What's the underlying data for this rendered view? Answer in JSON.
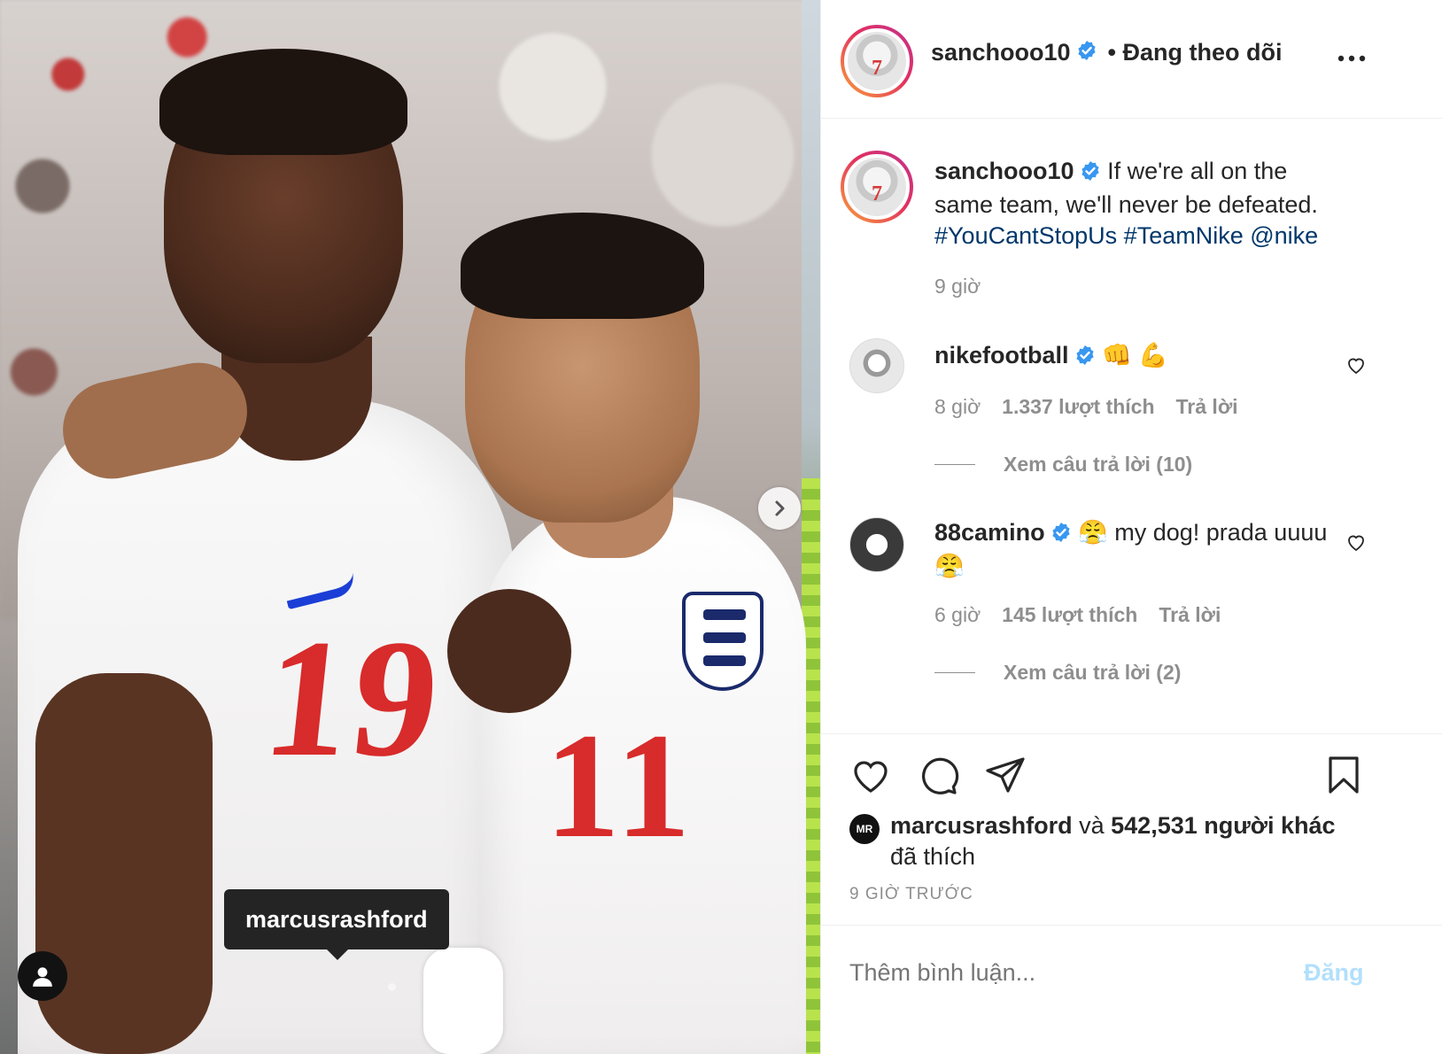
{
  "photo": {
    "tag_label": "marcusrashford",
    "jersey_left_number": "19",
    "jersey_right_number": "11"
  },
  "header": {
    "username": "sanchooo10",
    "follow_status": "• Đang theo dõi"
  },
  "caption": {
    "username": "sanchooo10",
    "text": "If we're all on the same team, we'll never be defeated.",
    "tags": [
      "#YouCantStopUs",
      "#TeamNike",
      "@nike"
    ],
    "time": "9 giờ"
  },
  "comments": [
    {
      "username": "nikefootball",
      "text": "👊 💪",
      "time": "8 giờ",
      "likes": "1.337 lượt thích",
      "reply_label": "Trả lời",
      "view_replies": "Xem câu trả lời (10)"
    },
    {
      "username": "88camino",
      "text": "😤  my dog! prada uuuu 😤",
      "time": "6 giờ",
      "likes": "145 lượt thích",
      "reply_label": "Trả lời",
      "view_replies": "Xem câu trả lời (2)"
    }
  ],
  "likes": {
    "user": "marcusrashford",
    "conjunction": "và",
    "others": "542,531 người khác",
    "suffix": "đã thích"
  },
  "post_age": "9 giờ trước",
  "add_comment": {
    "placeholder": "Thêm bình luận...",
    "post_label": "Đăng"
  },
  "colors": {
    "link": "#00376b",
    "verified": "#3897f0",
    "muted": "#8e8e8e",
    "post_disabled": "#b2dffc"
  }
}
